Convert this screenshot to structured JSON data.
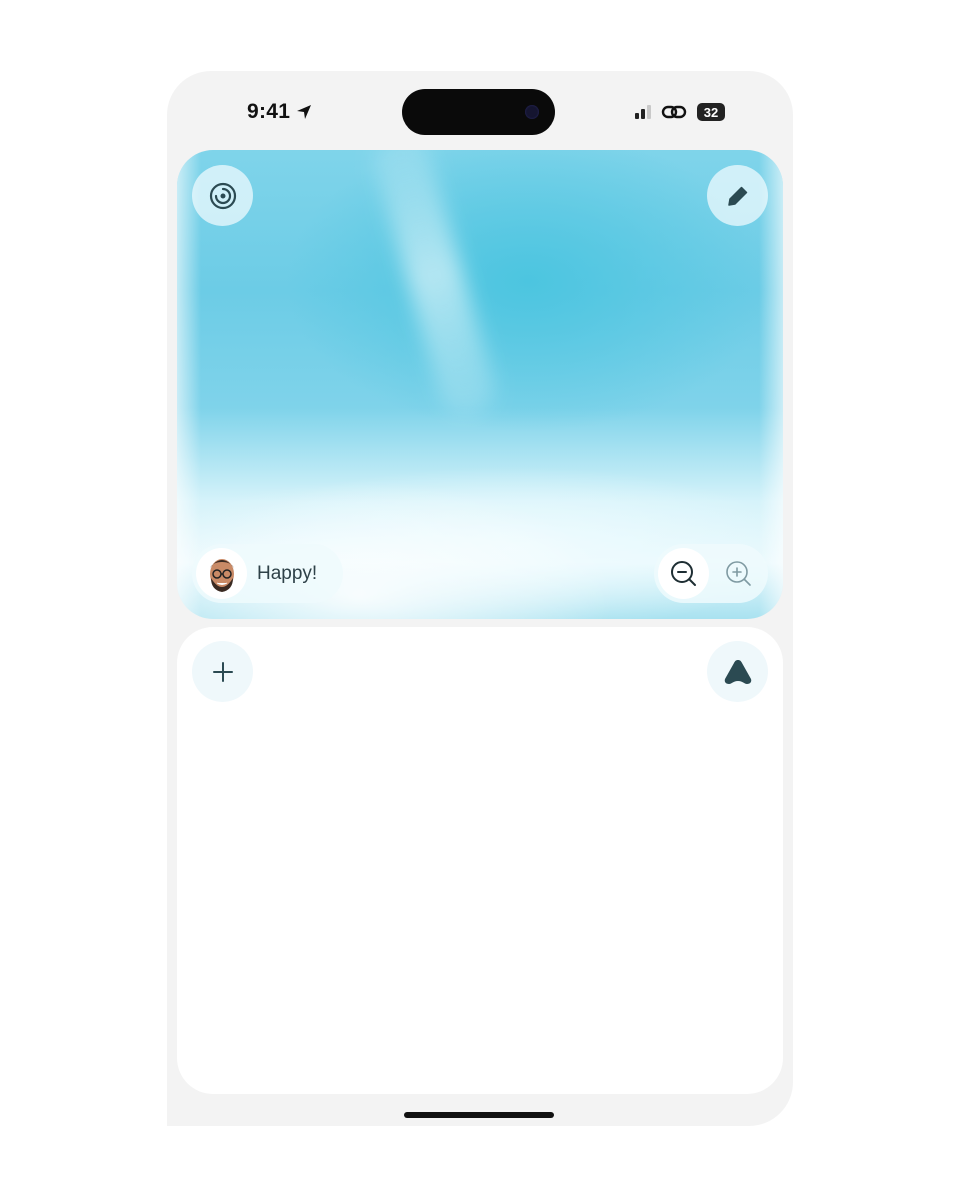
{
  "status_bar": {
    "time": "9:41",
    "battery": "32",
    "icons": [
      "location-arrow-icon",
      "signal-icon",
      "link-icon",
      "battery-icon"
    ]
  },
  "hero": {
    "activity_icon": "activity-rings-icon",
    "edit_icon": "pencil-icon",
    "mood": {
      "label": "Happy!",
      "avatar_icon": "memoji-avatar"
    },
    "zoom": {
      "out_icon": "zoom-out-icon",
      "in_icon": "zoom-in-icon"
    }
  },
  "panel": {
    "add_icon": "plus-icon",
    "brand_icon": "brand-logo-icon"
  },
  "colors": {
    "accent": "#5ec8e3",
    "text": "#2e4148",
    "icon": "#2b4a52"
  }
}
